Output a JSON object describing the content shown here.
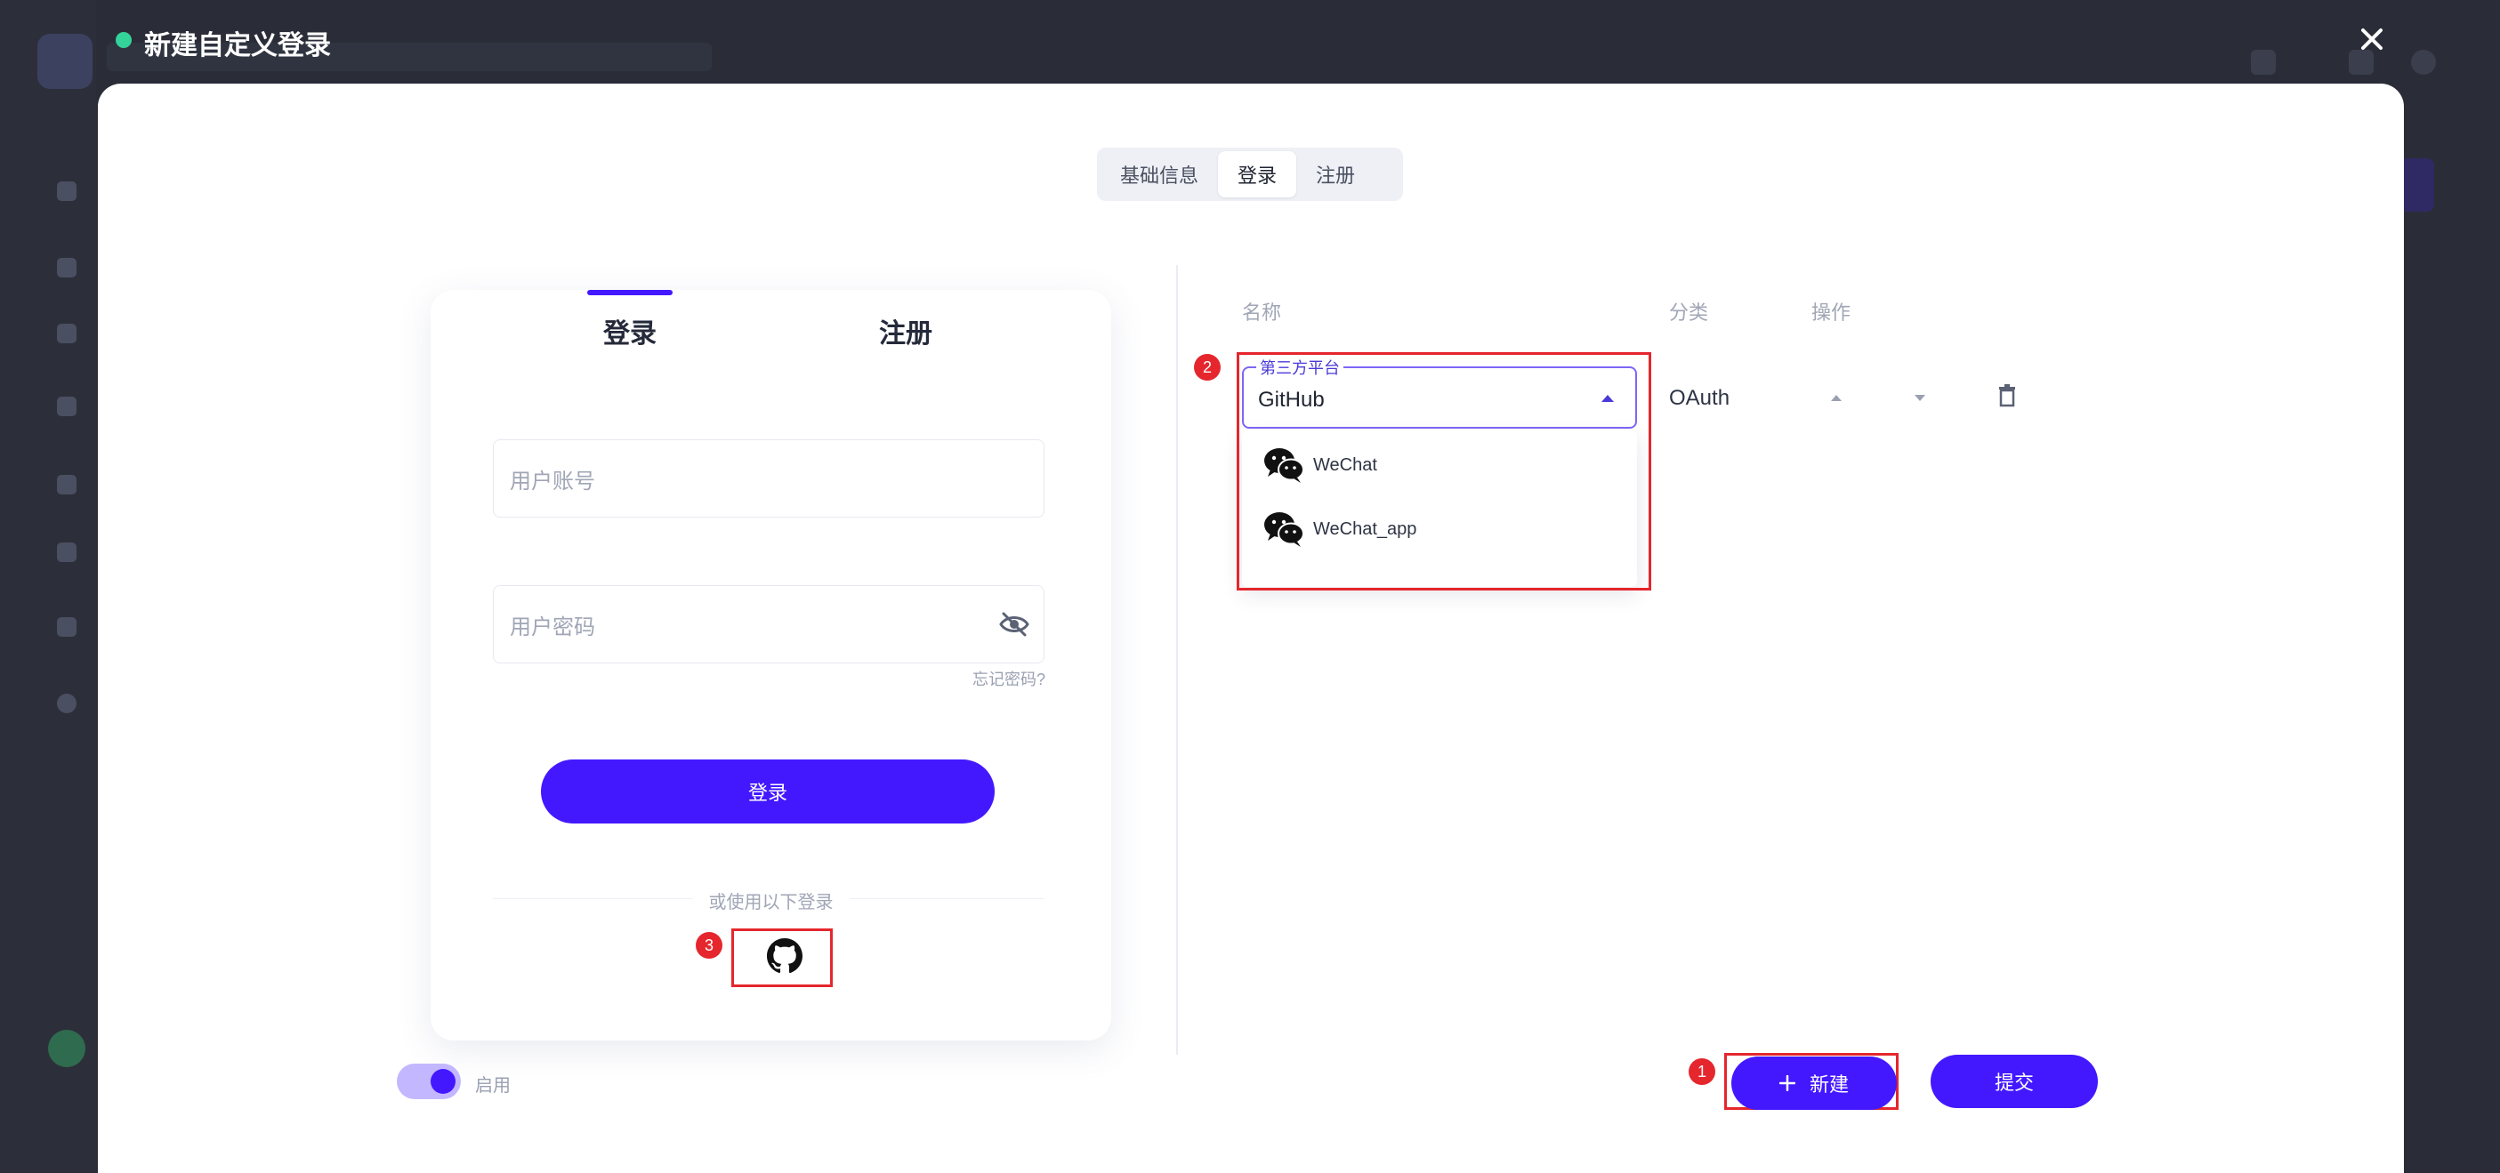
{
  "header": {
    "title": "新建自定义登录",
    "status_color": "#34d399"
  },
  "top_tabs": [
    {
      "label": "基础信息",
      "active": false
    },
    {
      "label": "登录",
      "active": true
    },
    {
      "label": "注册",
      "active": false
    }
  ],
  "preview": {
    "tabs": [
      {
        "label": "登录",
        "active": true
      },
      {
        "label": "注册",
        "active": false
      }
    ],
    "account_placeholder": "用户账号",
    "password_placeholder": "用户密码",
    "forgot_label": "忘记密码?",
    "login_button": "登录",
    "or_label": "或使用以下登录",
    "social_icons": [
      "github-icon"
    ]
  },
  "table": {
    "headers": {
      "name": "名称",
      "category": "分类",
      "actions": "操作"
    },
    "row": {
      "select_legend": "第三方平台",
      "select_value": "GitHub",
      "category": "OAuth"
    },
    "dropdown_options": [
      {
        "label": "WeChat",
        "icon": "wechat-icon"
      },
      {
        "label": "WeChat_app",
        "icon": "wechat-icon"
      }
    ]
  },
  "annotations": {
    "badge_1": "1",
    "badge_2": "2",
    "badge_3": "3"
  },
  "footer": {
    "toggle_label": "启用",
    "toggle_on": true,
    "new_button": "新建",
    "new_icon": "plus-icon",
    "submit_button": "提交"
  },
  "colors": {
    "accent": "#4318ff",
    "annotation_red": "#e5262d"
  }
}
